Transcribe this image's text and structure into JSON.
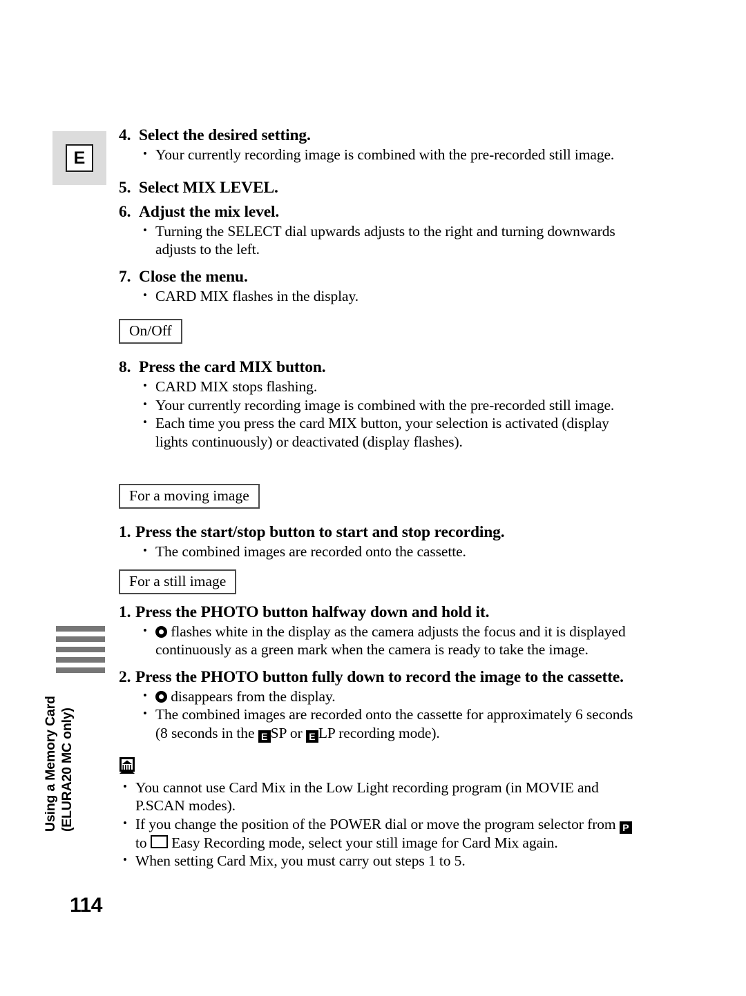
{
  "page": {
    "number": "114",
    "section_marker": "E",
    "sidebar_line1": "Using a Memory Card",
    "sidebar_line2": "(ELURA20 MC only)",
    "sidebar_bar_count": 5,
    "sidebar_bar_color": "#767676",
    "marker_background": "#dcdcdc"
  },
  "steps": [
    {
      "num": "4.",
      "title": "Select the desired setting.",
      "bullets": [
        "Your currently recording image is combined with the pre-recorded still image."
      ]
    },
    {
      "num": "5.",
      "title": "Select MIX LEVEL.",
      "bullets": []
    },
    {
      "num": "6.",
      "title": "Adjust the mix level.",
      "bullets": [
        "Turning the SELECT dial upwards adjusts to the right and turning downwards adjusts to the left."
      ]
    },
    {
      "num": "7.",
      "title": "Close the menu.",
      "bullets": [
        "CARD MIX flashes in the display."
      ]
    },
    {
      "num": "8.",
      "title": "Press the card MIX button.",
      "bullets": [
        "CARD MIX stops flashing.",
        "Your currently recording image is combined with the pre-recorded still image.",
        "Each time you press the card MIX button, your selection is activated (display lights continuously) or deactivated (display flashes)."
      ]
    }
  ],
  "labels": {
    "on_off": "On/Off",
    "for_moving_image": "For a moving image",
    "for_still_image": "For a still image"
  },
  "moving_image": {
    "num": "1.",
    "title": "Press the start/stop button to start and stop recording.",
    "bullets": [
      "The combined images are recorded onto the cassette."
    ]
  },
  "still_image": {
    "step1": {
      "num": "1.",
      "title": "Press the PHOTO button halfway down and hold it.",
      "bullet_icon": "photo-focus-mark-icon",
      "bullet_text": " flashes white in the display as the camera adjusts the focus and it is displayed continuously as a green mark when the camera is ready to take the image."
    },
    "step2": {
      "num": "2.",
      "title": "Press the PHOTO button fully down to record the image to the cassette.",
      "bullet1_icon": "photo-focus-mark-icon",
      "bullet1_text": " disappears from the display.",
      "bullet2_part1": "The combined images are recorded onto the cassette for approximately 6 seconds (8 seconds in the ",
      "bullet2_sp": "SP",
      "bullet2_mid": " or ",
      "bullet2_lp": "LP",
      "bullet2_part2": " recording mode)."
    }
  },
  "notes": {
    "icon": "memo-note-icon",
    "items": [
      {
        "text": "You cannot use Card Mix in the Low Light recording program (in MOVIE and P.SCAN modes)."
      },
      {
        "part1": "If you change the position of the POWER dial or move the program selector from ",
        "icon1": "program-ae-p-icon",
        "mid": " to ",
        "icon2": "easy-recording-icon",
        "part2": " Easy Recording mode, select your still image for Card Mix again."
      },
      {
        "text": "When setting Card Mix, you must carry out steps 1 to 5."
      }
    ]
  }
}
